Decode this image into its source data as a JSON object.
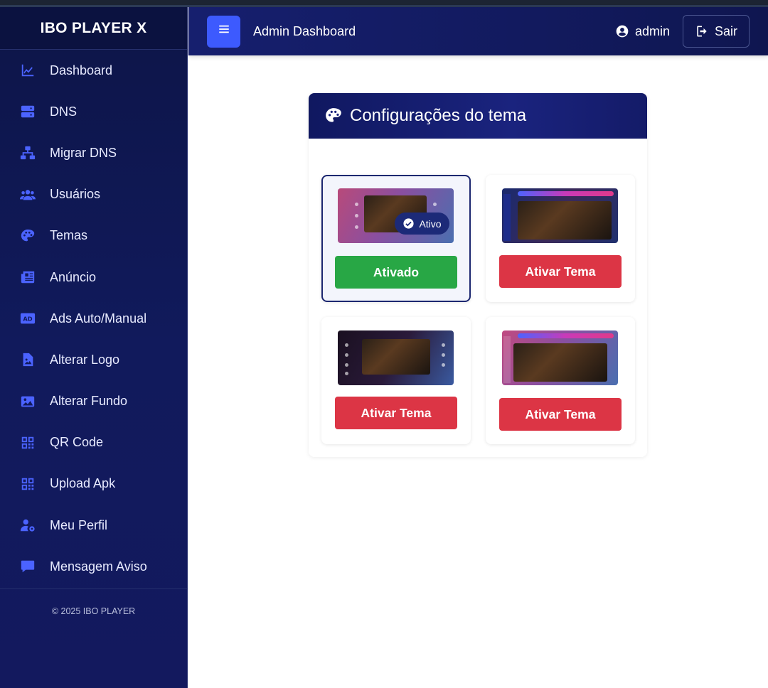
{
  "app": {
    "brand": "IBO PLAYER X",
    "footer": "© 2025 IBO PLAYER"
  },
  "sidebar": {
    "items": [
      {
        "label": "Dashboard",
        "icon": "chart-line-icon"
      },
      {
        "label": "DNS",
        "icon": "server-icon"
      },
      {
        "label": "Migrar DNS",
        "icon": "network-icon"
      },
      {
        "label": "Usuários",
        "icon": "users-icon"
      },
      {
        "label": "Temas",
        "icon": "palette-icon"
      },
      {
        "label": "Anúncio",
        "icon": "newspaper-icon"
      },
      {
        "label": "Ads Auto/Manual",
        "icon": "ad-icon"
      },
      {
        "label": "Alterar Logo",
        "icon": "file-image-icon"
      },
      {
        "label": "Alterar Fundo",
        "icon": "image-icon"
      },
      {
        "label": "QR Code",
        "icon": "qrcode-icon"
      },
      {
        "label": "Upload Apk",
        "icon": "qrcode-icon"
      },
      {
        "label": "Meu Perfil",
        "icon": "user-cog-icon"
      },
      {
        "label": "Mensagem Aviso",
        "icon": "comment-icon"
      }
    ]
  },
  "header": {
    "title": "Admin Dashboard",
    "user": "admin",
    "logout": "Sair"
  },
  "card": {
    "title": "Configurações do tema"
  },
  "themes": [
    {
      "button": "Ativado",
      "active": true,
      "badge": "Ativo"
    },
    {
      "button": "Ativar Tema",
      "active": false
    },
    {
      "button": "Ativar Tema",
      "active": false
    },
    {
      "button": "Ativar Tema",
      "active": false
    }
  ],
  "colors": {
    "accent": "#3d5afe",
    "active_button": "#28a745",
    "inactive_button": "#dc3545",
    "sidebar": "#111a5c"
  }
}
